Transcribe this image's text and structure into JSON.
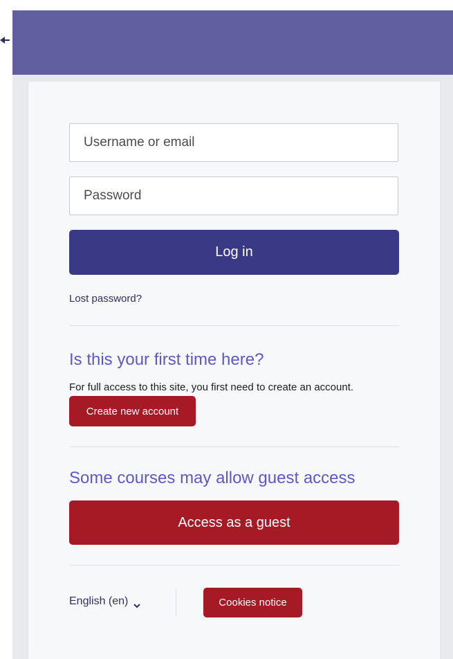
{
  "login": {
    "username_placeholder": "Username or email",
    "password_placeholder": "Password",
    "login_label": "Log in",
    "lost_password": "Lost password?"
  },
  "signup": {
    "heading": "Is this your first time here?",
    "info": "For full access to this site, you first need to create an account.",
    "create_label": "Create new account"
  },
  "guest": {
    "heading": "Some courses may allow guest access",
    "button_label": "Access as a guest"
  },
  "footer": {
    "language": "English (en)",
    "cookies_label": "Cookies notice"
  },
  "icons": {
    "back": "arrow-left-icon",
    "language_dropdown": "chevron-down-icon"
  },
  "colors": {
    "header": "#625f9e",
    "primary": "#393986",
    "danger": "#a51a24",
    "heading": "#5d58c8"
  }
}
